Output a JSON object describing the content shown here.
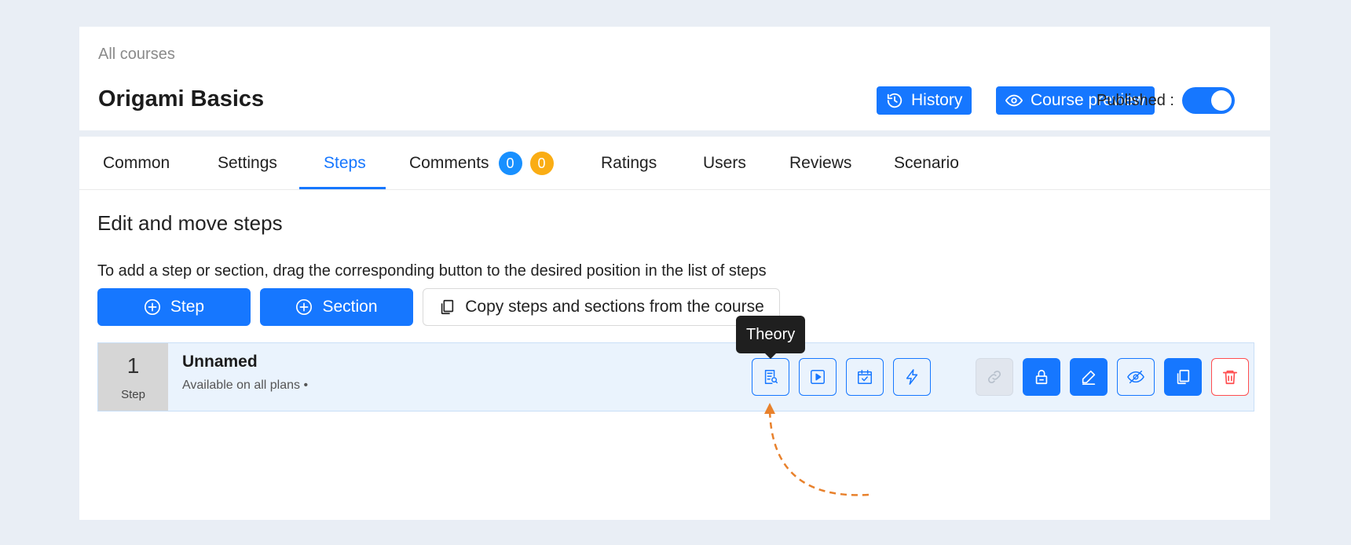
{
  "breadcrumb": "All courses",
  "course_title": "Origami Basics",
  "header": {
    "history_label": "History",
    "preview_label": "Course preview",
    "published_label": "Published :",
    "published": true
  },
  "tabs": [
    {
      "label": "Common"
    },
    {
      "label": "Settings"
    },
    {
      "label": "Steps",
      "active": true
    },
    {
      "label": "Comments",
      "badges": [
        "0",
        "0"
      ]
    },
    {
      "label": "Ratings"
    },
    {
      "label": "Users"
    },
    {
      "label": "Reviews"
    },
    {
      "label": "Scenario"
    }
  ],
  "steps_page": {
    "heading": "Edit and move steps",
    "hint": "To add a step or section, drag the corresponding button to the desired position in the list of steps",
    "add_step_label": "Step",
    "add_section_label": "Section",
    "copy_label": "Copy steps and sections from the course"
  },
  "step": {
    "number": "1",
    "number_label": "Step",
    "title": "Unnamed",
    "subtitle": "Available on all plans •"
  },
  "tooltip": "Theory",
  "icons": {
    "type_buttons": [
      "theory-icon",
      "video-icon",
      "task-icon",
      "lightning-icon"
    ],
    "action_buttons": [
      "link-icon",
      "lock-icon",
      "edit-icon",
      "eye-off-icon",
      "copy-icon",
      "trash-icon"
    ]
  },
  "colors": {
    "primary": "#1677ff",
    "danger": "#ff4d4f",
    "badge_blue": "#1890ff",
    "badge_orange": "#faad14",
    "annotation_arrow": "#e8812c"
  }
}
